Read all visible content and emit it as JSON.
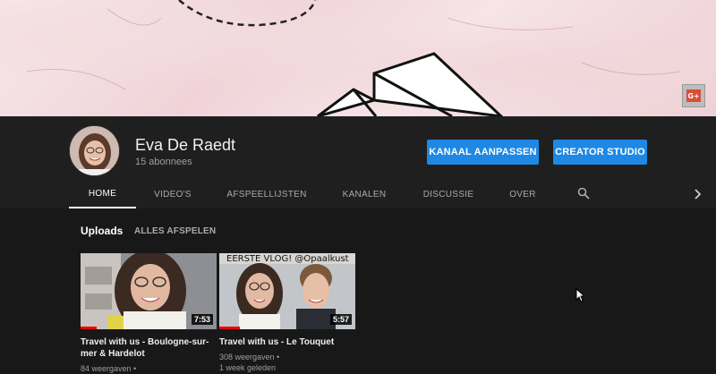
{
  "banner": {
    "gplus_label": "G+"
  },
  "channel": {
    "name": "Eva De Raedt",
    "subscribers": "15 abonnees",
    "customize_label": "KANAAL AANPASSEN",
    "studio_label": "CREATOR STUDIO"
  },
  "tabs": [
    {
      "label": "HOME",
      "active": true
    },
    {
      "label": "VIDEO'S"
    },
    {
      "label": "AFSPEELLIJSTEN"
    },
    {
      "label": "KANALEN"
    },
    {
      "label": "DISCUSSIE"
    },
    {
      "label": "OVER"
    }
  ],
  "tab_icons": {
    "search": "search-icon",
    "next": "chevron-right-icon"
  },
  "uploads": {
    "title": "Uploads",
    "play_all": "ALLES AFSPELEN",
    "videos": [
      {
        "title": "Travel with us - Boulogne-sur-mer & Hardelot",
        "duration": "7:53",
        "views": "84 weergaven •",
        "age": "",
        "watched": 0.12
      },
      {
        "title": "Travel with us - Le Touquet",
        "duration": "5:57",
        "views": "308 weergaven •",
        "age": "1 week geleden",
        "thumb_caption": "EERSTE VLOG! @Opaalkust",
        "watched": 0.15
      }
    ]
  },
  "colors": {
    "accent": "#1e88e5",
    "progress": "#ee0000",
    "background": "#181818"
  }
}
